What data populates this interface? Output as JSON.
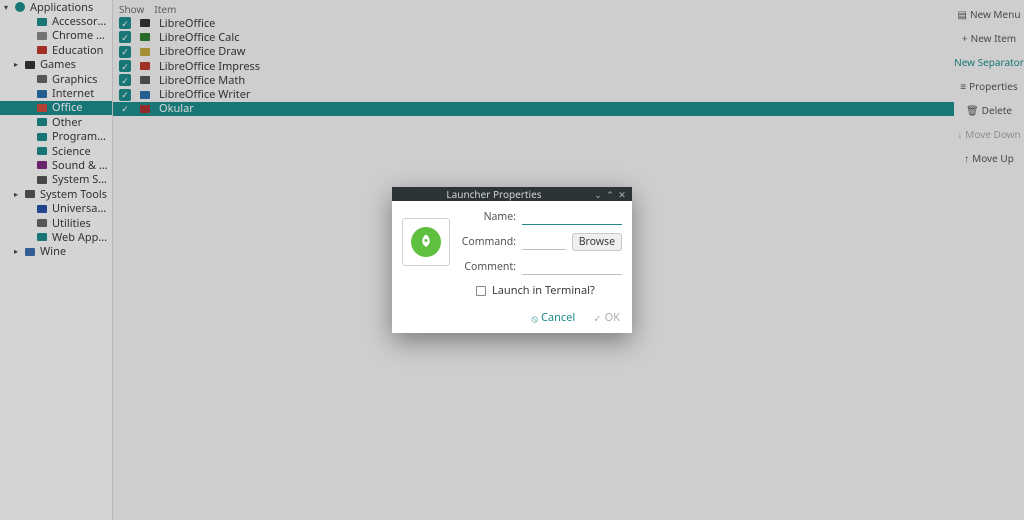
{
  "tree": {
    "root": "Applications",
    "items": [
      {
        "label": "Accessories",
        "arrow": "",
        "icon": "folder-teal"
      },
      {
        "label": "Chrome Apps",
        "arrow": "",
        "icon": "chrome"
      },
      {
        "label": "Education",
        "arrow": "",
        "icon": "education"
      },
      {
        "label": "Games",
        "arrow": "▸",
        "icon": "games"
      },
      {
        "label": "Graphics",
        "arrow": "",
        "icon": "graphics"
      },
      {
        "label": "Internet",
        "arrow": "",
        "icon": "internet"
      },
      {
        "label": "Office",
        "arrow": "",
        "icon": "office",
        "selected": true
      },
      {
        "label": "Other",
        "arrow": "",
        "icon": "other"
      },
      {
        "label": "Programming",
        "arrow": "",
        "icon": "programming"
      },
      {
        "label": "Science",
        "arrow": "",
        "icon": "science"
      },
      {
        "label": "Sound & Video",
        "arrow": "",
        "icon": "media"
      },
      {
        "label": "System Settings",
        "arrow": "",
        "icon": "settings"
      },
      {
        "label": "System Tools",
        "arrow": "▸",
        "icon": "tools"
      },
      {
        "label": "Universal Access",
        "arrow": "",
        "icon": "accessibility"
      },
      {
        "label": "Utilities",
        "arrow": "",
        "icon": "utilities"
      },
      {
        "label": "Web Applications",
        "arrow": "",
        "icon": "web"
      },
      {
        "label": "Wine",
        "arrow": "▸",
        "icon": "wine"
      }
    ]
  },
  "center": {
    "header_show": "Show",
    "header_item": "Item",
    "items": [
      {
        "label": "LibreOffice",
        "icon": "lo-start",
        "checked": true
      },
      {
        "label": "LibreOffice Calc",
        "icon": "lo-calc",
        "checked": true
      },
      {
        "label": "LibreOffice Draw",
        "icon": "lo-draw",
        "checked": true
      },
      {
        "label": "LibreOffice Impress",
        "icon": "lo-impress",
        "checked": true
      },
      {
        "label": "LibreOffice Math",
        "icon": "lo-math",
        "checked": true
      },
      {
        "label": "LibreOffice Writer",
        "icon": "lo-writer",
        "checked": true
      },
      {
        "label": "Okular",
        "icon": "okular",
        "checked": true,
        "selected": true
      }
    ]
  },
  "actions": {
    "new_menu": "New Menu",
    "new_item": "New Item",
    "new_sep": "New Separator",
    "properties": "Properties",
    "delete": "Delete",
    "move_down": "Move Down",
    "move_up": "Move Up"
  },
  "dialog": {
    "title": "Launcher Properties",
    "name": "Name:",
    "command": "Command:",
    "comment": "Comment:",
    "browse": "Browse",
    "terminal": "Launch in Terminal?",
    "cancel": "Cancel",
    "ok": "OK",
    "name_value": "",
    "command_value": "",
    "comment_value": ""
  },
  "icon_colors": {
    "folder-teal": "#1d8b8b",
    "chrome": "#888",
    "education": "#c0392b",
    "games": "#333",
    "graphics": "#666",
    "internet": "#2b6fa8",
    "office": "#d04c3f",
    "other": "#1d8b8b",
    "programming": "#1d8b8b",
    "science": "#1d8b8b",
    "media": "#7b2b7b",
    "settings": "#555",
    "tools": "#555",
    "accessibility": "#2b4fa8",
    "utilities": "#666",
    "web": "#1d8b8b",
    "wine": "#3b6fb0",
    "lo-start": "#333",
    "lo-calc": "#2e7d32",
    "lo-draw": "#c2a83e",
    "lo-impress": "#c0392b",
    "lo-math": "#555",
    "lo-writer": "#2b6fa8",
    "okular": "#b03030",
    "applications": "#1d8b8b"
  }
}
